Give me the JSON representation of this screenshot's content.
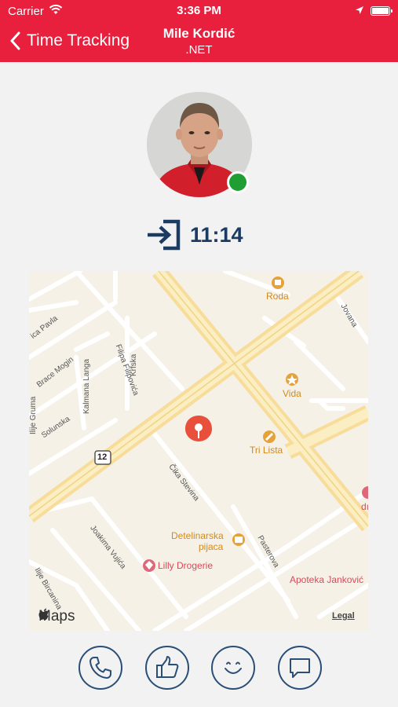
{
  "status_bar": {
    "carrier": "Carrier",
    "time": "3:36 PM"
  },
  "nav": {
    "back_label": "Time Tracking",
    "title": "Mile Kordić",
    "subtitle": ".NET"
  },
  "profile": {
    "status_color": "#1f9e34",
    "status": "online"
  },
  "checkin": {
    "time": "11:14",
    "icon": "sign-in-icon"
  },
  "map": {
    "streets": [
      "Filipa Filipovića",
      "Krfska",
      "Kalmana Langa",
      "Brace Mogin",
      "Solunska",
      "Čika Stevina",
      "Joakima Vujića",
      "Pasterova",
      "Jovana",
      "Ilije Bircanina",
      "ica Pavla",
      "Ilije Gruma"
    ],
    "route_number": "12",
    "pois": [
      "Roda",
      "Vida",
      "Tri Lista",
      "Detelinarska",
      "pijaca",
      "Lilly Drogerie",
      "Apoteka Janković",
      "dı"
    ],
    "logo": "Maps",
    "legal": "Legal"
  },
  "actions": [
    {
      "name": "call-button",
      "icon": "phone-icon"
    },
    {
      "name": "like-button",
      "icon": "thumbs-up-icon"
    },
    {
      "name": "emoji-button",
      "icon": "smiley-icon"
    },
    {
      "name": "message-button",
      "icon": "chat-bubble-icon"
    }
  ],
  "colors": {
    "brand": "#e8203d",
    "accent": "#1b3b63",
    "button_outline": "#2a4e75"
  }
}
